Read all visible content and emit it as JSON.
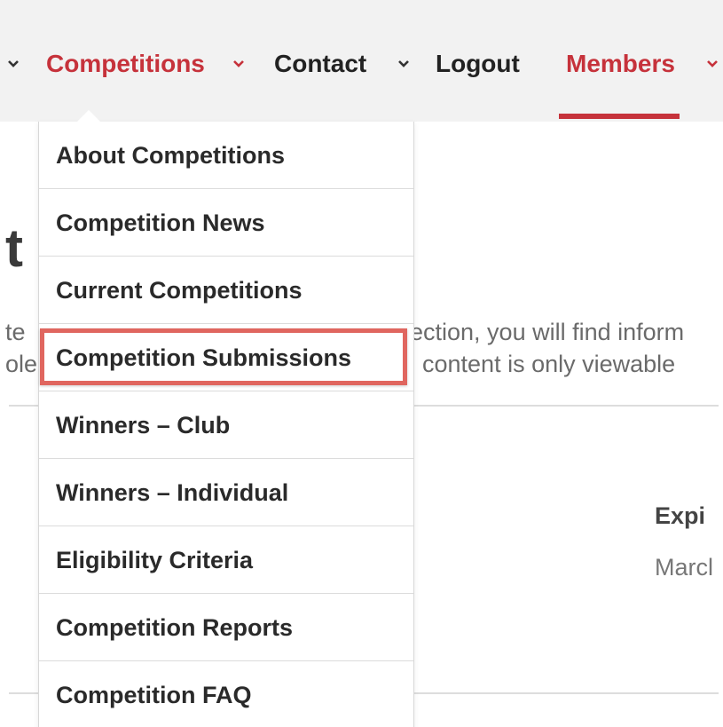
{
  "nav": {
    "items": [
      {
        "label": "Competitions",
        "color": "#c6323b"
      },
      {
        "label": "Contact",
        "color": "#222222"
      },
      {
        "label": "Logout",
        "color": "#222222"
      },
      {
        "label": "Members",
        "color": "#c6323b"
      }
    ],
    "active_item": "Members",
    "chevron_icon": "chevron-down-icon"
  },
  "dropdown": {
    "items": [
      {
        "label": "About Competitions"
      },
      {
        "label": "Competition News"
      },
      {
        "label": "Current Competitions"
      },
      {
        "label": "Competition Submissions"
      },
      {
        "label": "Winners – Club"
      },
      {
        "label": "Winners – Individual"
      },
      {
        "label": "Eligibility Criteria"
      },
      {
        "label": "Competition Reports"
      },
      {
        "label": "Competition FAQ"
      }
    ],
    "highlighted_item": "Competition Submissions",
    "highlight_color": "#e0665f"
  },
  "background": {
    "heading_fragment": "t",
    "line1_left": "te",
    "line1_right": "ection, you will find inform",
    "line2_left": "ole",
    "line2_right": "content is only viewable",
    "label_fragment": "Expi",
    "value_fragment": "Marcl"
  }
}
